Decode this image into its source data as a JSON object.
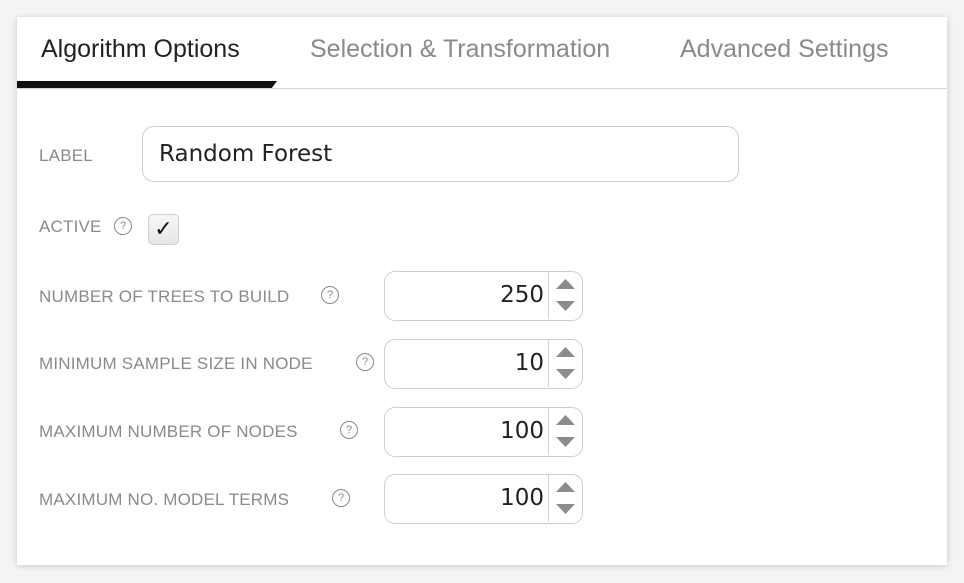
{
  "tabs": [
    {
      "label": "Algorithm Options",
      "active": true
    },
    {
      "label": "Selection & Transformation",
      "active": false
    },
    {
      "label": "Advanced Settings",
      "active": false
    }
  ],
  "form": {
    "label": {
      "caption": "LABEL",
      "value": "Random Forest"
    },
    "active": {
      "caption": "ACTIVE",
      "checked": true,
      "check_glyph": "✓"
    },
    "help_glyph": "?",
    "numeric_fields": [
      {
        "caption": "NUMBER OF TREES TO BUILD",
        "value": "250"
      },
      {
        "caption": "MINIMUM SAMPLE SIZE IN NODE",
        "value": "10"
      },
      {
        "caption": "MAXIMUM NUMBER OF NODES",
        "value": "100"
      },
      {
        "caption": "MAXIMUM NO. MODEL TERMS",
        "value": "100"
      }
    ]
  },
  "icons": {
    "help": "help-circle-icon",
    "check": "checkmark-icon",
    "spinner_up": "triangle-up-icon",
    "spinner_down": "triangle-down-icon"
  },
  "colors": {
    "active_tab_text": "#222222",
    "inactive_tab_text": "#8a8a8a",
    "tab_underline": "#111111",
    "label_text": "#8a8a8a",
    "input_border": "#cfcfcf",
    "spinner_arrow": "#8c8c8c"
  }
}
